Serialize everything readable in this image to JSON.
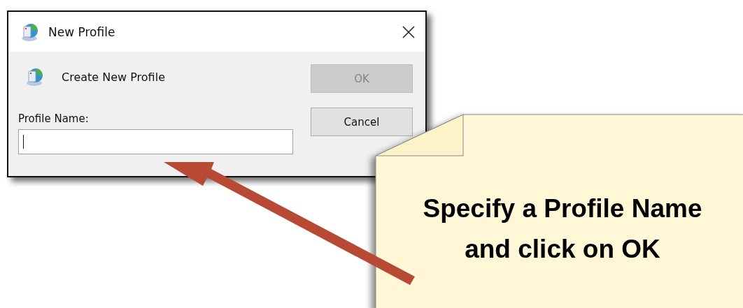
{
  "dialog": {
    "title": "New Profile",
    "heading": "Create New Profile",
    "buttons": [
      {
        "label": "OK",
        "disabled": true
      },
      {
        "label": "Cancel",
        "disabled": false
      }
    ],
    "field": {
      "label": "Profile Name:",
      "focused": true
    }
  },
  "callout": {
    "text": "Specify a Profile Name\nand click on OK"
  }
}
